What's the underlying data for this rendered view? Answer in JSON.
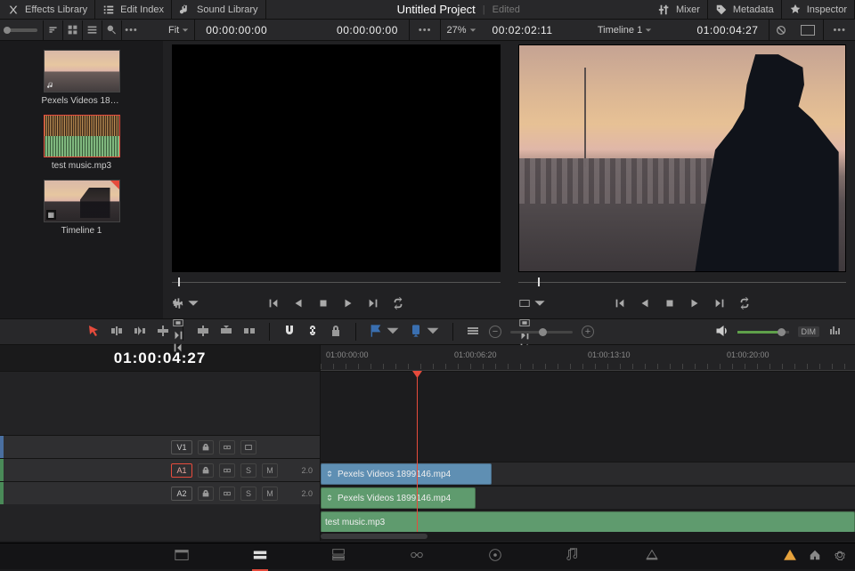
{
  "topbar": {
    "left": [
      {
        "icon": "fx",
        "label": "Effects Library"
      },
      {
        "icon": "list",
        "label": "Edit Index"
      },
      {
        "icon": "note",
        "label": "Sound Library"
      }
    ],
    "title": "Untitled Project",
    "status": "Edited",
    "right": [
      {
        "icon": "sliders",
        "label": "Mixer"
      },
      {
        "icon": "tag",
        "label": "Metadata"
      },
      {
        "icon": "inspector",
        "label": "Inspector"
      }
    ]
  },
  "mediapool": {
    "items": [
      {
        "label": "Pexels Videos 18991...",
        "type": "video"
      },
      {
        "label": "test music.mp3",
        "type": "audio",
        "selected": true
      },
      {
        "label": "Timeline 1",
        "type": "timeline",
        "dogear": true
      }
    ]
  },
  "source_viewer": {
    "fit_label": "Fit",
    "tc_left": "00:00:00:00",
    "tc_right": "00:00:00:00",
    "scrub_pos_pct": 2
  },
  "timeline_viewer": {
    "zoom_pct": "27%",
    "duration_tc": "00:02:02:11",
    "timeline_label": "Timeline 1",
    "tc_right": "01:00:04:27",
    "scrub_pos_pct": 6
  },
  "timeline": {
    "big_tc": "01:00:04:27",
    "ruler": [
      {
        "label": "01:00:00:00",
        "pct": 1
      },
      {
        "label": "01:00:06:20",
        "pct": 25
      },
      {
        "label": "01:00:13:10",
        "pct": 50
      },
      {
        "label": "01:00:20:00",
        "pct": 76
      }
    ],
    "playhead_pct": 18,
    "tracks": {
      "video": {
        "name": "V1"
      },
      "a1": {
        "name": "A1",
        "ch": "2.0",
        "selected": true
      },
      "a2": {
        "name": "A2",
        "ch": "2.0"
      }
    },
    "clips": {
      "v1": {
        "label": "Pexels Videos 1899146.mp4",
        "start_pct": 0,
        "width_pct": 32
      },
      "a1": {
        "label": "Pexels Videos 1899146.mp4",
        "start_pct": 0,
        "width_pct": 29
      },
      "a2": {
        "label": "test music.mp3",
        "start_pct": 0,
        "width_pct": 100
      }
    }
  },
  "toolbar2": {
    "flag1_color": "#3a6fb0",
    "flag2_color": "#3a6fb0",
    "dim_label": "DIM"
  },
  "bottombar": {
    "pages": [
      "media",
      "cut",
      "edit",
      "fusion",
      "color",
      "fairlight",
      "deliver"
    ],
    "active_page": 1
  }
}
